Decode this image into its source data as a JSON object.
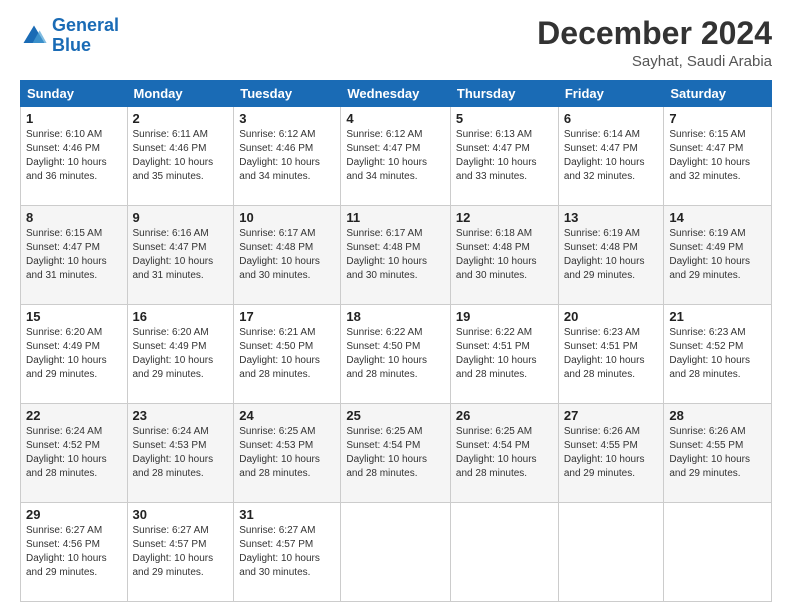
{
  "logo": {
    "line1": "General",
    "line2": "Blue"
  },
  "title": "December 2024",
  "subtitle": "Sayhat, Saudi Arabia",
  "weekdays": [
    "Sunday",
    "Monday",
    "Tuesday",
    "Wednesday",
    "Thursday",
    "Friday",
    "Saturday"
  ],
  "weeks": [
    [
      {
        "day": "1",
        "info": "Sunrise: 6:10 AM\nSunset: 4:46 PM\nDaylight: 10 hours\nand 36 minutes."
      },
      {
        "day": "2",
        "info": "Sunrise: 6:11 AM\nSunset: 4:46 PM\nDaylight: 10 hours\nand 35 minutes."
      },
      {
        "day": "3",
        "info": "Sunrise: 6:12 AM\nSunset: 4:46 PM\nDaylight: 10 hours\nand 34 minutes."
      },
      {
        "day": "4",
        "info": "Sunrise: 6:12 AM\nSunset: 4:47 PM\nDaylight: 10 hours\nand 34 minutes."
      },
      {
        "day": "5",
        "info": "Sunrise: 6:13 AM\nSunset: 4:47 PM\nDaylight: 10 hours\nand 33 minutes."
      },
      {
        "day": "6",
        "info": "Sunrise: 6:14 AM\nSunset: 4:47 PM\nDaylight: 10 hours\nand 32 minutes."
      },
      {
        "day": "7",
        "info": "Sunrise: 6:15 AM\nSunset: 4:47 PM\nDaylight: 10 hours\nand 32 minutes."
      }
    ],
    [
      {
        "day": "8",
        "info": "Sunrise: 6:15 AM\nSunset: 4:47 PM\nDaylight: 10 hours\nand 31 minutes."
      },
      {
        "day": "9",
        "info": "Sunrise: 6:16 AM\nSunset: 4:47 PM\nDaylight: 10 hours\nand 31 minutes."
      },
      {
        "day": "10",
        "info": "Sunrise: 6:17 AM\nSunset: 4:48 PM\nDaylight: 10 hours\nand 30 minutes."
      },
      {
        "day": "11",
        "info": "Sunrise: 6:17 AM\nSunset: 4:48 PM\nDaylight: 10 hours\nand 30 minutes."
      },
      {
        "day": "12",
        "info": "Sunrise: 6:18 AM\nSunset: 4:48 PM\nDaylight: 10 hours\nand 30 minutes."
      },
      {
        "day": "13",
        "info": "Sunrise: 6:19 AM\nSunset: 4:48 PM\nDaylight: 10 hours\nand 29 minutes."
      },
      {
        "day": "14",
        "info": "Sunrise: 6:19 AM\nSunset: 4:49 PM\nDaylight: 10 hours\nand 29 minutes."
      }
    ],
    [
      {
        "day": "15",
        "info": "Sunrise: 6:20 AM\nSunset: 4:49 PM\nDaylight: 10 hours\nand 29 minutes."
      },
      {
        "day": "16",
        "info": "Sunrise: 6:20 AM\nSunset: 4:49 PM\nDaylight: 10 hours\nand 29 minutes."
      },
      {
        "day": "17",
        "info": "Sunrise: 6:21 AM\nSunset: 4:50 PM\nDaylight: 10 hours\nand 28 minutes."
      },
      {
        "day": "18",
        "info": "Sunrise: 6:22 AM\nSunset: 4:50 PM\nDaylight: 10 hours\nand 28 minutes."
      },
      {
        "day": "19",
        "info": "Sunrise: 6:22 AM\nSunset: 4:51 PM\nDaylight: 10 hours\nand 28 minutes."
      },
      {
        "day": "20",
        "info": "Sunrise: 6:23 AM\nSunset: 4:51 PM\nDaylight: 10 hours\nand 28 minutes."
      },
      {
        "day": "21",
        "info": "Sunrise: 6:23 AM\nSunset: 4:52 PM\nDaylight: 10 hours\nand 28 minutes."
      }
    ],
    [
      {
        "day": "22",
        "info": "Sunrise: 6:24 AM\nSunset: 4:52 PM\nDaylight: 10 hours\nand 28 minutes."
      },
      {
        "day": "23",
        "info": "Sunrise: 6:24 AM\nSunset: 4:53 PM\nDaylight: 10 hours\nand 28 minutes."
      },
      {
        "day": "24",
        "info": "Sunrise: 6:25 AM\nSunset: 4:53 PM\nDaylight: 10 hours\nand 28 minutes."
      },
      {
        "day": "25",
        "info": "Sunrise: 6:25 AM\nSunset: 4:54 PM\nDaylight: 10 hours\nand 28 minutes."
      },
      {
        "day": "26",
        "info": "Sunrise: 6:25 AM\nSunset: 4:54 PM\nDaylight: 10 hours\nand 28 minutes."
      },
      {
        "day": "27",
        "info": "Sunrise: 6:26 AM\nSunset: 4:55 PM\nDaylight: 10 hours\nand 29 minutes."
      },
      {
        "day": "28",
        "info": "Sunrise: 6:26 AM\nSunset: 4:55 PM\nDaylight: 10 hours\nand 29 minutes."
      }
    ],
    [
      {
        "day": "29",
        "info": "Sunrise: 6:27 AM\nSunset: 4:56 PM\nDaylight: 10 hours\nand 29 minutes."
      },
      {
        "day": "30",
        "info": "Sunrise: 6:27 AM\nSunset: 4:57 PM\nDaylight: 10 hours\nand 29 minutes."
      },
      {
        "day": "31",
        "info": "Sunrise: 6:27 AM\nSunset: 4:57 PM\nDaylight: 10 hours\nand 30 minutes."
      },
      null,
      null,
      null,
      null
    ]
  ]
}
